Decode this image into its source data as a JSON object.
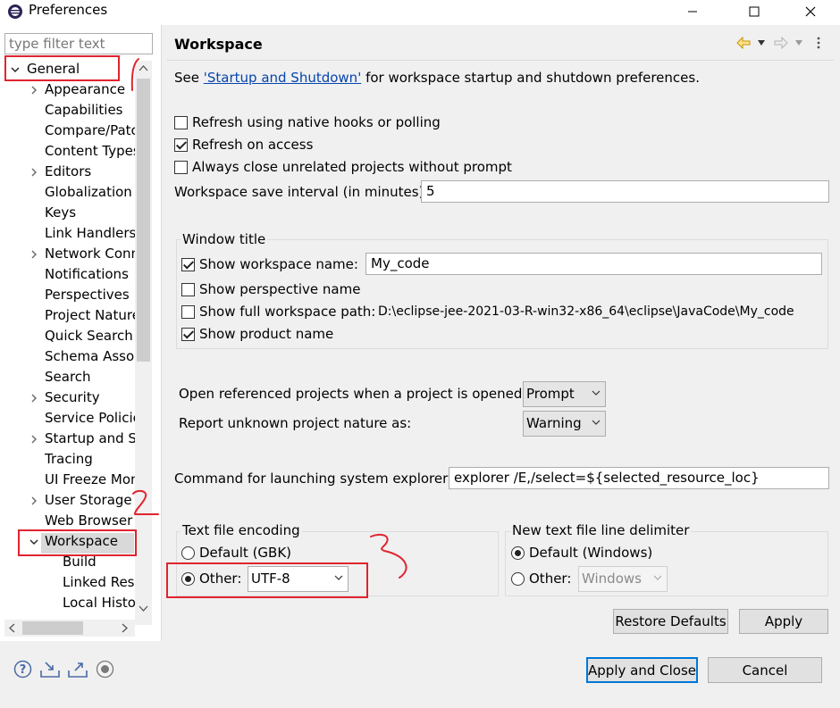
{
  "window": {
    "title": "Preferences",
    "minimize_glyph": "—",
    "maximize_glyph": "☐",
    "close_glyph": "✕"
  },
  "left": {
    "filter_placeholder": "type filter text",
    "tree": [
      {
        "label": "General",
        "expanded": true
      },
      {
        "label": "Appearance",
        "expander": true
      },
      {
        "label": "Capabilities"
      },
      {
        "label": "Compare/Patch"
      },
      {
        "label": "Content Types"
      },
      {
        "label": "Editors",
        "expander": true
      },
      {
        "label": "Globalization"
      },
      {
        "label": "Keys"
      },
      {
        "label": "Link Handlers"
      },
      {
        "label": "Network Connections",
        "expander": true
      },
      {
        "label": "Notifications"
      },
      {
        "label": "Perspectives"
      },
      {
        "label": "Project Natures"
      },
      {
        "label": "Quick Search"
      },
      {
        "label": "Schema Associations"
      },
      {
        "label": "Search"
      },
      {
        "label": "Security",
        "expander": true
      },
      {
        "label": "Service Policies"
      },
      {
        "label": "Startup and Shutdown",
        "expander": true
      },
      {
        "label": "Tracing"
      },
      {
        "label": "UI Freeze Monitoring"
      },
      {
        "label": "User Storage",
        "expander": true
      },
      {
        "label": "Web Browser"
      },
      {
        "label": "Workspace",
        "expanded": true,
        "selected": true
      },
      {
        "label": "Build"
      },
      {
        "label": "Linked Resources"
      },
      {
        "label": "Local History"
      }
    ]
  },
  "page": {
    "title": "Workspace",
    "intro_prefix": "See ",
    "intro_link": "'Startup and Shutdown'",
    "intro_suffix": " for workspace startup and shutdown preferences.",
    "options": [
      {
        "label": "Refresh using native hooks or polling",
        "checked": false
      },
      {
        "label": "Refresh on access",
        "checked": true
      },
      {
        "label": "Always close unrelated projects without prompt",
        "checked": false
      }
    ],
    "save_interval_label": "Workspace save interval (in minutes):",
    "save_interval_value": "5",
    "window_title_group": {
      "legend": "Window title",
      "show_workspace_name": {
        "label": "Show workspace name:",
        "checked": true,
        "value": "My_code"
      },
      "show_perspective_name": {
        "label": "Show perspective name",
        "checked": false
      },
      "show_full_path": {
        "label": "Show full workspace path:",
        "checked": false,
        "value": "D:\\eclipse-jee-2021-03-R-win32-x86_64\\eclipse\\JavaCode\\My_code"
      },
      "show_product_name": {
        "label": "Show product name",
        "checked": true
      }
    },
    "open_referenced_label": "Open referenced projects when a project is opened:",
    "open_referenced_value": "Prompt",
    "report_unknown_label": "Report unknown project nature as:",
    "report_unknown_value": "Warning",
    "command_label": "Command for launching system explorer:",
    "command_value": "explorer /E,/select=${selected_resource_loc}",
    "encoding_group": {
      "legend": "Text file encoding",
      "default_label": "Default (GBK)",
      "other_label": "Other:",
      "other_value": "UTF-8",
      "selected": "other"
    },
    "line_delimiter_group": {
      "legend": "New text file line delimiter",
      "default_label": "Default (Windows)",
      "other_label": "Other:",
      "other_value": "Windows",
      "selected": "default"
    },
    "restore_defaults_label": "Restore Defaults",
    "apply_label": "Apply"
  },
  "footer": {
    "apply_close_label": "Apply and Close",
    "cancel_label": "Cancel"
  },
  "annotations": [
    "1",
    "2",
    "3"
  ],
  "colors": {
    "highlight": "#e0242f",
    "link": "#0645ad",
    "default_button_border": "#0078d7"
  }
}
